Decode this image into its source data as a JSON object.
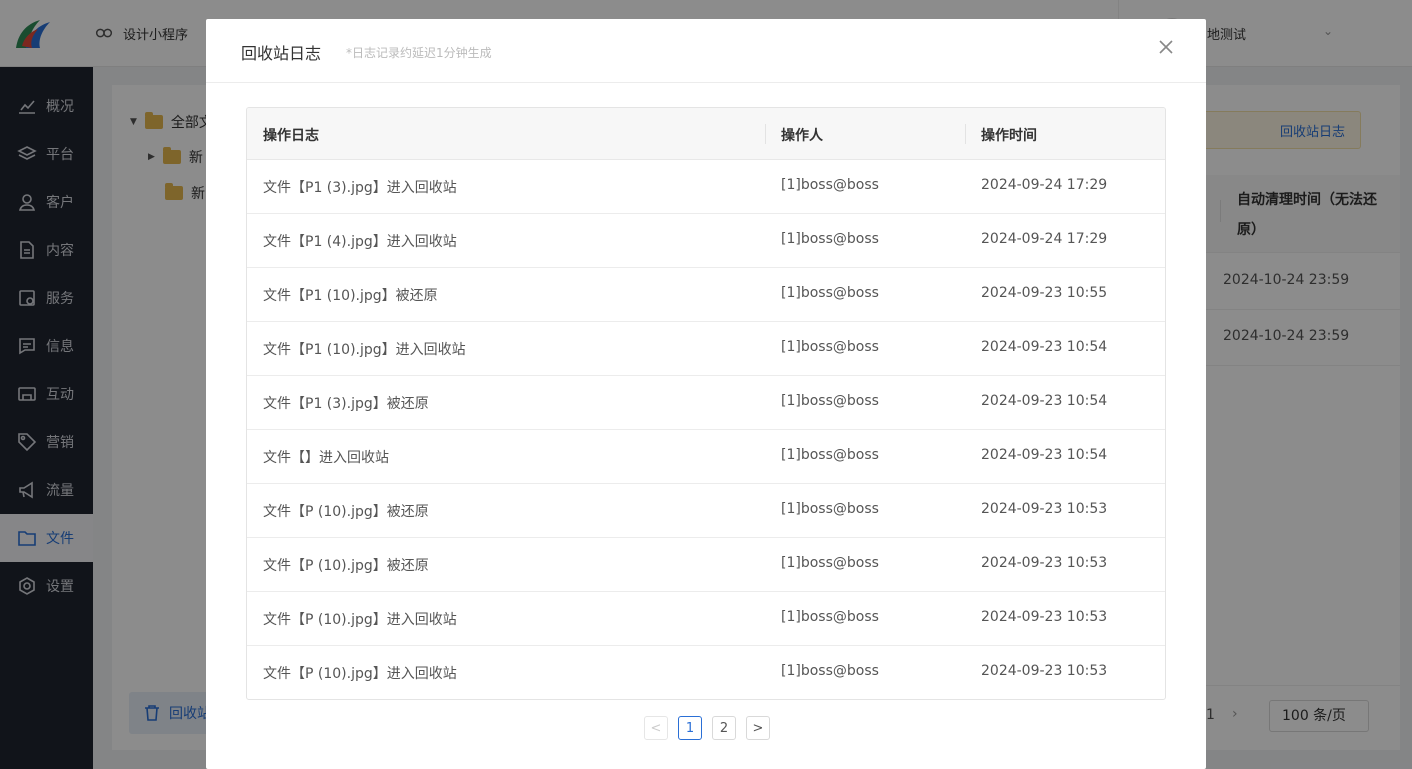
{
  "header": {
    "app_switch_label": "设计小程序",
    "store_name": "地测试"
  },
  "sidebar": {
    "items": [
      {
        "label": "概况",
        "icon": "chart-line-icon"
      },
      {
        "label": "平台",
        "icon": "layers-icon"
      },
      {
        "label": "客户",
        "icon": "user-icon"
      },
      {
        "label": "内容",
        "icon": "document-icon"
      },
      {
        "label": "服务",
        "icon": "service-icon"
      },
      {
        "label": "信息",
        "icon": "message-icon"
      },
      {
        "label": "互动",
        "icon": "interaction-icon"
      },
      {
        "label": "营销",
        "icon": "tag-icon"
      },
      {
        "label": "流量",
        "icon": "megaphone-icon"
      },
      {
        "label": "文件",
        "icon": "folder-icon",
        "active": true
      },
      {
        "label": "设置",
        "icon": "gear-icon"
      }
    ]
  },
  "tree": {
    "root_label": "全部文",
    "child1_label": "新",
    "child2_label": "新"
  },
  "recycle_button_label": "回收站",
  "background_table": {
    "warn_link": "回收站日志",
    "header": "自动清理时间（无法还原）",
    "rows": [
      "2024-10-24 23:59",
      "2024-10-24 23:59"
    ],
    "page_num": "1",
    "page_size": "100 条/页"
  },
  "modal": {
    "title": "回收站日志",
    "subtitle": "*日志记录约延迟1分钟生成",
    "columns": [
      "操作日志",
      "操作人",
      "操作时间"
    ],
    "rows": [
      {
        "log": "文件【P1 (3).jpg】进入回收站",
        "operator": "[1]boss@boss",
        "time": "2024-09-24 17:29"
      },
      {
        "log": "文件【P1 (4).jpg】进入回收站",
        "operator": "[1]boss@boss",
        "time": "2024-09-24 17:29"
      },
      {
        "log": "文件【P1 (10).jpg】被还原",
        "operator": "[1]boss@boss",
        "time": "2024-09-23 10:55"
      },
      {
        "log": "文件【P1 (10).jpg】进入回收站",
        "operator": "[1]boss@boss",
        "time": "2024-09-23 10:54"
      },
      {
        "log": "文件【P1 (3).jpg】被还原",
        "operator": "[1]boss@boss",
        "time": "2024-09-23 10:54"
      },
      {
        "log": "文件【】进入回收站",
        "operator": "[1]boss@boss",
        "time": "2024-09-23 10:54"
      },
      {
        "log": "文件【P (10).jpg】被还原",
        "operator": "[1]boss@boss",
        "time": "2024-09-23 10:53"
      },
      {
        "log": "文件【P (10).jpg】被还原",
        "operator": "[1]boss@boss",
        "time": "2024-09-23 10:53"
      },
      {
        "log": "文件【P (10).jpg】进入回收站",
        "operator": "[1]boss@boss",
        "time": "2024-09-23 10:53"
      },
      {
        "log": "文件【P (10).jpg】进入回收站",
        "operator": "[1]boss@boss",
        "time": "2024-09-23 10:53"
      }
    ],
    "pagination": {
      "prev": "<",
      "pages": [
        "1",
        "2"
      ],
      "current": "1",
      "next": ">"
    }
  }
}
